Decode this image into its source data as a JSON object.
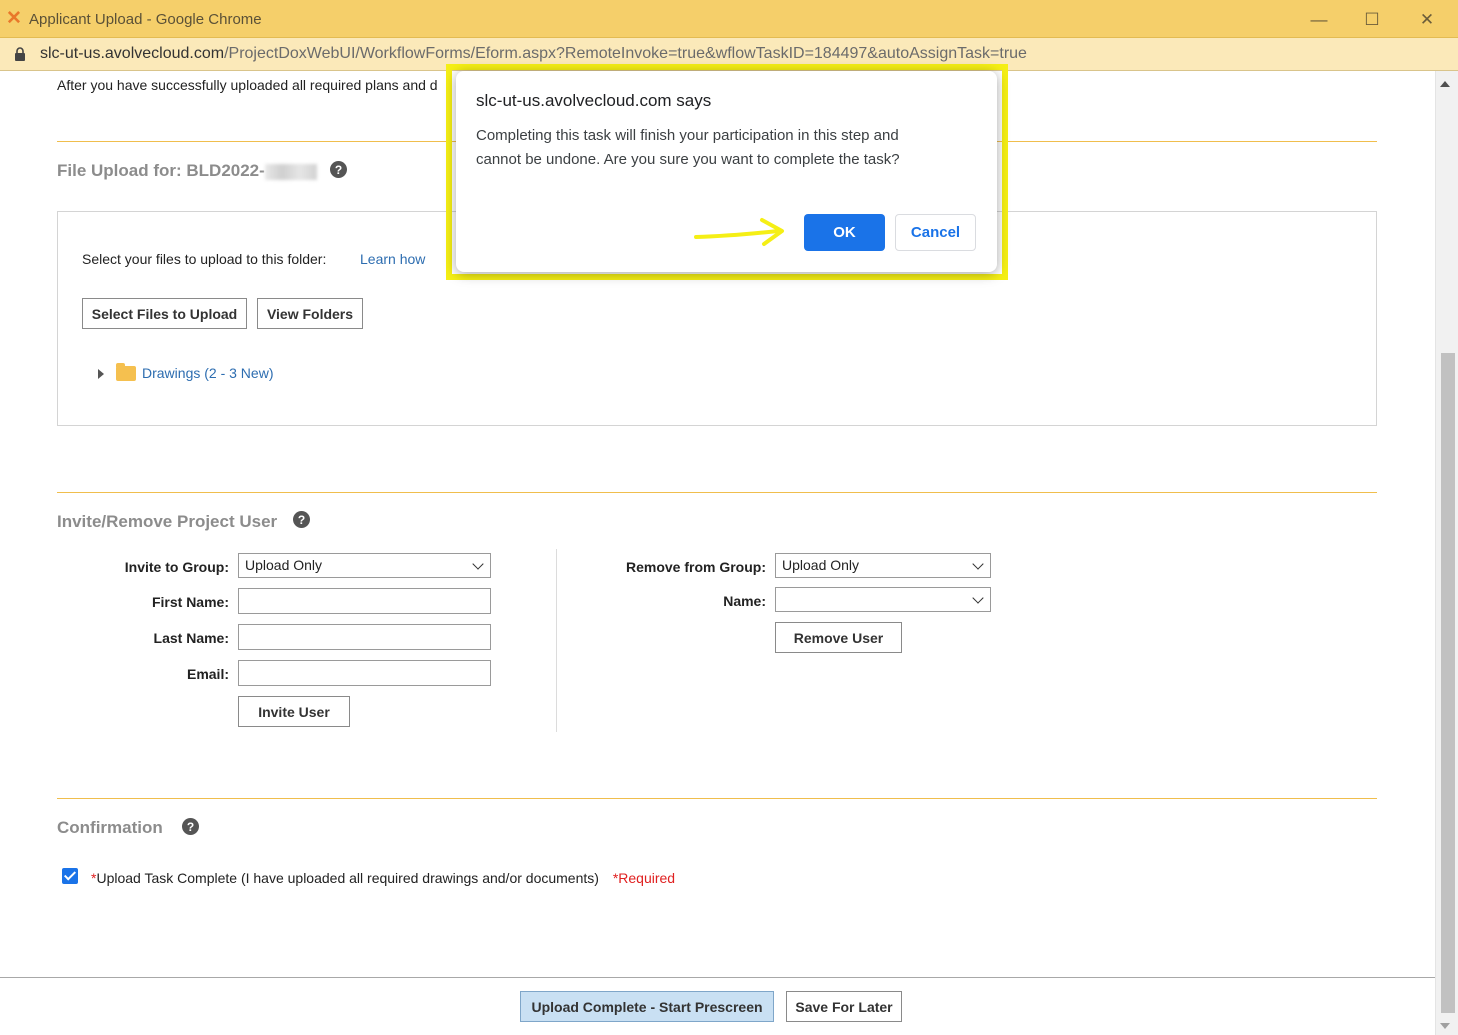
{
  "window": {
    "title": "Applicant Upload - Google Chrome",
    "url_host": "slc-ut-us.avolvecloud.com",
    "url_path": "/ProjectDoxWebUI/WorkflowForms/Eform.aspx?RemoteInvoke=true&wflowTaskID=184497&autoAssignTask=true"
  },
  "page": {
    "intro_text": "After you have successfully uploaded all required plans and d",
    "file_upload": {
      "title": "File Upload for: BLD2022-",
      "select_label": "Select your files to upload to this folder:",
      "learn_how": "Learn how",
      "select_files_button": "Select Files to Upload",
      "view_folders_button": "View Folders",
      "folder_label": "Drawings (2 - 3 New)"
    },
    "invite": {
      "title": "Invite/Remove Project User",
      "invite_group_label": "Invite to Group:",
      "invite_group_value": "Upload Only",
      "first_name_label": "First Name:",
      "first_name_value": "",
      "last_name_label": "Last Name:",
      "last_name_value": "",
      "email_label": "Email:",
      "email_value": "",
      "invite_button": "Invite User",
      "remove_group_label": "Remove from Group:",
      "remove_group_value": "Upload Only",
      "name_label": "Name:",
      "name_value": "",
      "remove_button": "Remove User"
    },
    "confirmation": {
      "title": "Confirmation",
      "checked": true,
      "asterisk": "*",
      "text": "Upload Task Complete (I have uploaded all required drawings and/or documents)",
      "required": "*Required"
    },
    "footer": {
      "complete_button": "Upload Complete - Start Prescreen",
      "save_button": "Save For Later"
    }
  },
  "dialog": {
    "origin": "slc-ut-us.avolvecloud.com says",
    "message": "Completing this task will finish your participation in this step and cannot be undone. Are you sure you want to complete the task?",
    "ok": "OK",
    "cancel": "Cancel"
  },
  "icons": {
    "app": "projectdox-x-icon",
    "lock": "lock-icon",
    "help": "help-circle-icon",
    "folder": "folder-icon",
    "arrow": "arrow-right-annotation"
  },
  "colors": {
    "titlebar": "#f5cf6a",
    "accent_rule": "#f0be4d",
    "link": "#2d6db0",
    "primary_button": "#1a73e8",
    "highlight": "#f5ef15",
    "required": "#e02020"
  }
}
